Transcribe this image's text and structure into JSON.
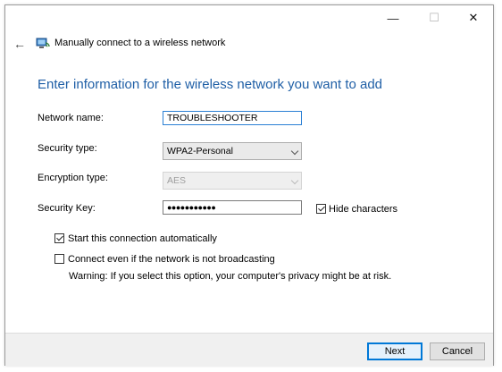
{
  "window": {
    "title": "Manually connect to a wireless network",
    "controls": {
      "minimize": "—",
      "maximize": "☐",
      "close": "✕"
    },
    "back_glyph": "←"
  },
  "heading": "Enter information for the wireless network you want to add",
  "form": {
    "network_name": {
      "label": "Network name:",
      "value": "TROUBLESHOOTER"
    },
    "security_type": {
      "label": "Security type:",
      "value": "WPA2-Personal"
    },
    "encryption_type": {
      "label": "Encryption type:",
      "value": "AES"
    },
    "security_key": {
      "label": "Security Key:",
      "value": "●●●●●●●●●●●"
    },
    "hide_characters": {
      "label": "Hide characters",
      "checked": true
    }
  },
  "options": {
    "auto_start": {
      "label": "Start this connection automatically",
      "checked": true
    },
    "connect_hidden": {
      "label": "Connect even if the network is not broadcasting",
      "checked": false
    },
    "warning": "Warning: If you select this option, your computer's privacy might be at risk."
  },
  "buttons": {
    "next": "Next",
    "cancel": "Cancel"
  },
  "icons": {
    "back": "back-arrow-icon",
    "network": "wireless-network-icon"
  },
  "colors": {
    "heading": "#1f5fa6",
    "focus": "#2a7fd4",
    "primary_button_border": "#0078d7"
  }
}
